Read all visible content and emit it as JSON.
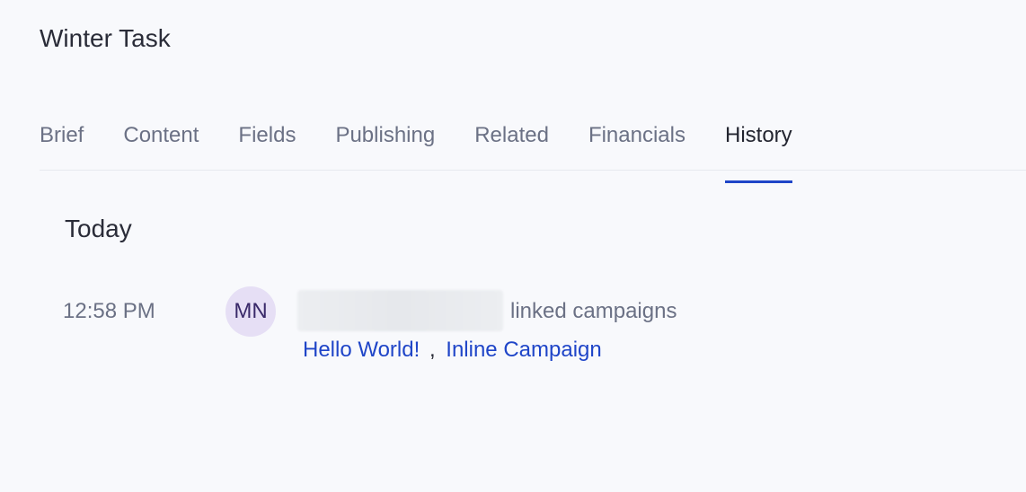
{
  "header": {
    "title": "Winter Task"
  },
  "tabs": [
    {
      "label": "Brief",
      "active": false
    },
    {
      "label": "Content",
      "active": false
    },
    {
      "label": "Fields",
      "active": false
    },
    {
      "label": "Publishing",
      "active": false
    },
    {
      "label": "Related",
      "active": false
    },
    {
      "label": "Financials",
      "active": false
    },
    {
      "label": "History",
      "active": true
    }
  ],
  "history": {
    "day_heading": "Today",
    "events": [
      {
        "time": "12:58 PM",
        "avatar_initials": "MN",
        "action": "linked campaigns",
        "links": [
          "Hello World!",
          "Inline Campaign"
        ],
        "separator": ","
      }
    ]
  },
  "colors": {
    "accent": "#1f45c8",
    "avatar_bg": "#e6dff5",
    "muted_text": "#6b7185",
    "background": "#f8f9fc"
  }
}
